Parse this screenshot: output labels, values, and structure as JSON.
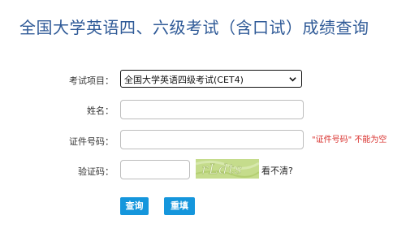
{
  "page": {
    "title": "全国大学英语四、六级考试（含口试）成绩查询"
  },
  "form": {
    "exam_label": "考试项目：",
    "exam_selected": "全国大学英语四级考试(CET4)",
    "name_label": "姓名：",
    "name_value": "",
    "id_label": "证件号码：",
    "id_value": "",
    "id_error": "\"证件号码\" 不能为空",
    "captcha_label": "验证码：",
    "captcha_value": "",
    "captcha_image_text": "rLdts",
    "captcha_refresh": "看不清?"
  },
  "buttons": {
    "query": "查询",
    "reset": "重填"
  },
  "colors": {
    "title": "#2f5a97",
    "button": "#1596dc",
    "error": "#d9302d",
    "captcha_bg": "#c5dc8c"
  }
}
